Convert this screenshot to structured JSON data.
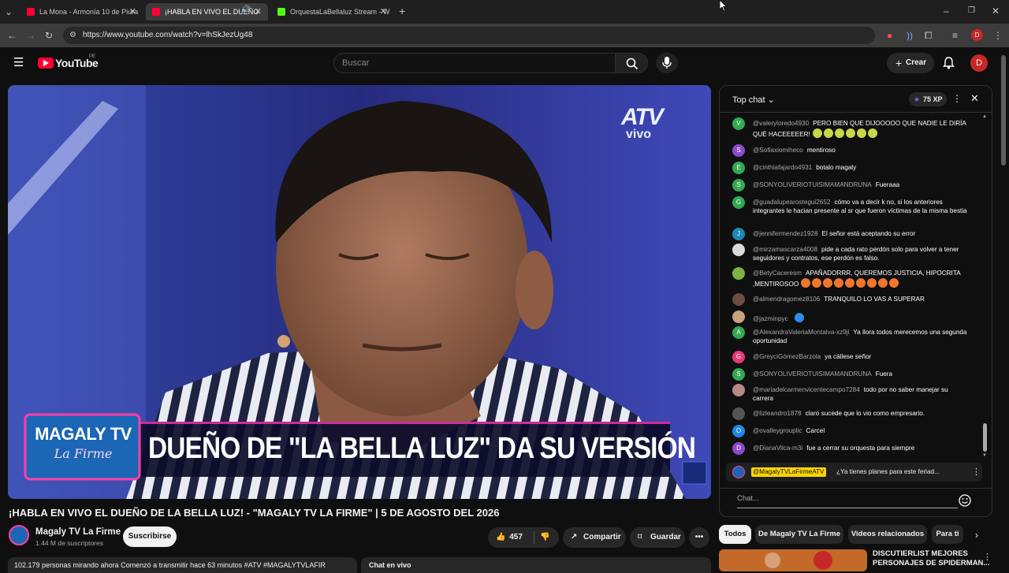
{
  "tabs": [
    {
      "title": "La Mona - Armonía 10 de Piura",
      "color": "#ff0033"
    },
    {
      "title": "¡HABLA EN VIVO EL DUEÑO",
      "color": "#ff0033"
    },
    {
      "title": "OrquestaLaBellaluz Stream - W",
      "color": "#53fc18"
    }
  ],
  "url": "https://www.youtube.com/watch?v=lhSkJezUg48",
  "header": {
    "logo": "YouTube",
    "region": "PE",
    "search_placeholder": "Buscar",
    "create_label": "Crear",
    "avatar_letter": "D"
  },
  "video": {
    "channel_logo_top": "ATV",
    "channel_logo_bottom": "vivo",
    "show_name_top": "MAGALY TV",
    "show_name_bottom": "La Firme",
    "caption": "DUEÑO DE \"LA BELLA LUZ\" DA SU VERSIÓN"
  },
  "meta": {
    "title": "¡HABLA EN VIVO EL DUEÑO DE LA BELLA LUZ! - \"MAGALY TV LA FIRME\" | 5 DE AGOSTO DEL 2026",
    "channel_name": "Magaly TV La Firme",
    "subscribers": "1.44 M de suscriptores",
    "subscribe_label": "Suscribirse",
    "likes": "457",
    "share_label": "Compartir",
    "save_label": "Guardar",
    "watching_text": "102.179 personas mirando ahora  Comenzó a transmitir hace 63 minutos  #ATV #MAGALYTVLAFIR",
    "chat_replay_label": "Chat en vivo"
  },
  "chat": {
    "title": "Top chat",
    "xp": "75 XP",
    "pinned_author": "@MagalyTVLaFirmeATV",
    "pinned_text": "¿Ya tienes planes para este feriad...",
    "input_placeholder": "Chat...",
    "messages": [
      {
        "initial": "V",
        "color": "#33a852",
        "author": "@valeryloredo4930",
        "text": "PERO BIEN QUE DIJOOOOO QUE NADIE LE DIRÍA QUÉ HACEEEEER!",
        "emojis": 6,
        "emoji_color": "#c7d64a"
      },
      {
        "initial": "S",
        "color": "#8b49c9",
        "author": "@Sofiaxiomiheco",
        "text": "mentiroso"
      },
      {
        "initial": "E",
        "color": "#33a852",
        "author": "@cinthiafajardo4931",
        "text": "botalo magaly"
      },
      {
        "initial": "S",
        "color": "#33a852",
        "author": "@SONYOLIVERIOTUISIMAMANDRUNA",
        "text": "Fueraaa"
      },
      {
        "initial": "G",
        "color": "#33a852",
        "author": "@guadalupearostegui2652",
        "text": "cómo va a decir k no, si los anteriores integrantes le hacian presente al sr que fueron víctimas de la misma bestia"
      },
      {
        "initial": "J",
        "color": "#1e88b4",
        "author": "@jennifermendez1928",
        "text": "El señor está aceptando su error"
      },
      {
        "initial": "",
        "color": "#d9d9d9",
        "author": "@mirzamascarza4008",
        "text": "pide a cada rato perdón solo para volver a tener seguidores y contratos, ese perdón es falso."
      },
      {
        "initial": "",
        "color": "#7cb342",
        "author": "@BetyCaceresm",
        "text": "APAÑADORRR, QUEREMOS JUSTICIA, HIPOCRITA ,MENTIROSOO",
        "emojis": 9,
        "emoji_color": "#f0762b"
      },
      {
        "initial": "",
        "color": "#6d4c41",
        "author": "@almendragomez8106",
        "text": "TRANQUILO LO VAS A SUPERAR"
      },
      {
        "initial": "",
        "color": "#c9a27e",
        "author": "@jazminpyc",
        "text": "",
        "emojis": 1,
        "emoji_color": "#2b8df0"
      },
      {
        "initial": "A",
        "color": "#33a852",
        "author": "@AlexandraValeriaMontalva-xz9jl",
        "text": "Ya llora todos merecemos una segunda oportunidad"
      },
      {
        "initial": "G",
        "color": "#e53977",
        "author": "@GreyciGómezBarzola",
        "text": "ya cállese señor"
      },
      {
        "initial": "S",
        "color": "#33a852",
        "author": "@SONYOLIVERIOTUISIMAMANDRUNA",
        "text": "Fuera"
      },
      {
        "initial": "",
        "color": "#b58a86",
        "author": "@mariadelcarmenvicentecampo7284",
        "text": "todo por no saber manejar su carrera"
      },
      {
        "initial": "",
        "color": "#555555",
        "author": "@lizleandro1878",
        "text": "claro sucede que lo vio como empresario."
      },
      {
        "initial": "O",
        "color": "#1e88e5",
        "author": "@ovalleygrouplic",
        "text": "Carcel"
      },
      {
        "initial": "D",
        "color": "#8b49c9",
        "author": "@DianaVilca-m3i",
        "text": "fue a cerrar su orquesta para siempre"
      }
    ]
  },
  "chips": [
    "Todos",
    "De Magaly TV La Firme",
    "Videos relacionados",
    "Para ti"
  ],
  "recommended": {
    "title_line1": "DISCUTIERLIST MEJORES",
    "title_line2": "PERSONAJES DE SPIDERMAN..."
  },
  "colors": {
    "accent_red": "#ff0033",
    "mod_yellow": "#ffd600",
    "xp_purple": "#7b61ff"
  }
}
